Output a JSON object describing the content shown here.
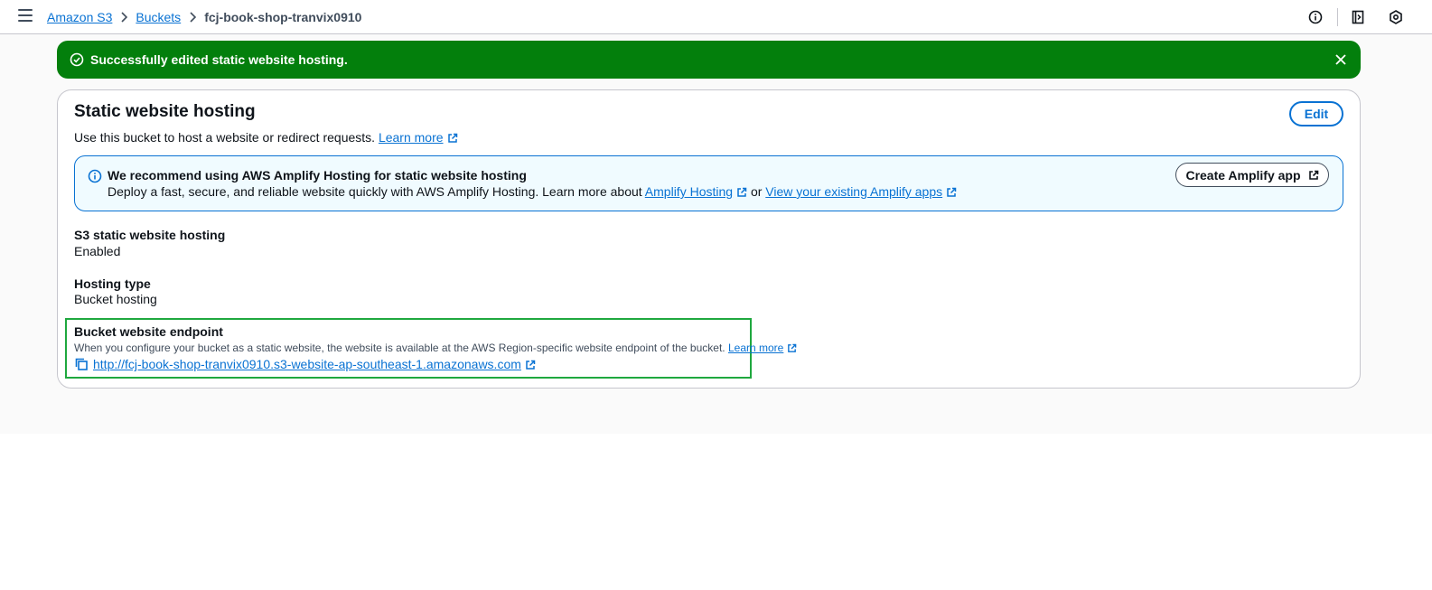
{
  "breadcrumb": {
    "items": [
      {
        "label": "Amazon S3"
      },
      {
        "label": "Buckets"
      }
    ],
    "current": "fcj-book-shop-tranvix0910"
  },
  "flash": {
    "message": "Successfully edited static website hosting.",
    "color": "#037f0c"
  },
  "panel": {
    "title": "Static website hosting",
    "description": "Use this bucket to host a website or redirect requests.",
    "learn_more": "Learn more",
    "edit_label": "Edit"
  },
  "info": {
    "title": "We recommend using AWS Amplify Hosting for static website hosting",
    "body_prefix": "Deploy a fast, secure, and reliable website quickly with AWS Amplify Hosting. Learn more about",
    "link1": "Amplify Hosting",
    "connector": "or",
    "link2": "View your existing Amplify apps",
    "button_label": "Create Amplify app"
  },
  "details": {
    "hosting_label": "S3 static website hosting",
    "hosting_value": "Enabled",
    "type_label": "Hosting type",
    "type_value": "Bucket hosting",
    "endpoint_label": "Bucket website endpoint",
    "endpoint_desc": "When you configure your bucket as a static website, the website is available at the AWS Region-specific website endpoint of the bucket.",
    "endpoint_learn_more": "Learn more",
    "endpoint_url": "http://fcj-book-shop-tranvix0910.s3-website-ap-southeast-1.amazonaws.com"
  },
  "icons": {
    "menu": "menu-icon",
    "info": "info-icon",
    "notes": "notes-icon",
    "settings": "settings-hexagon-icon",
    "success": "check-circle-icon",
    "close": "close-icon",
    "external": "external-link-icon",
    "copy": "copy-icon"
  },
  "colors": {
    "link": "#0972d3",
    "success": "#037f0c",
    "highlight": "#1fa83f",
    "info_bg": "#f0fbff"
  }
}
